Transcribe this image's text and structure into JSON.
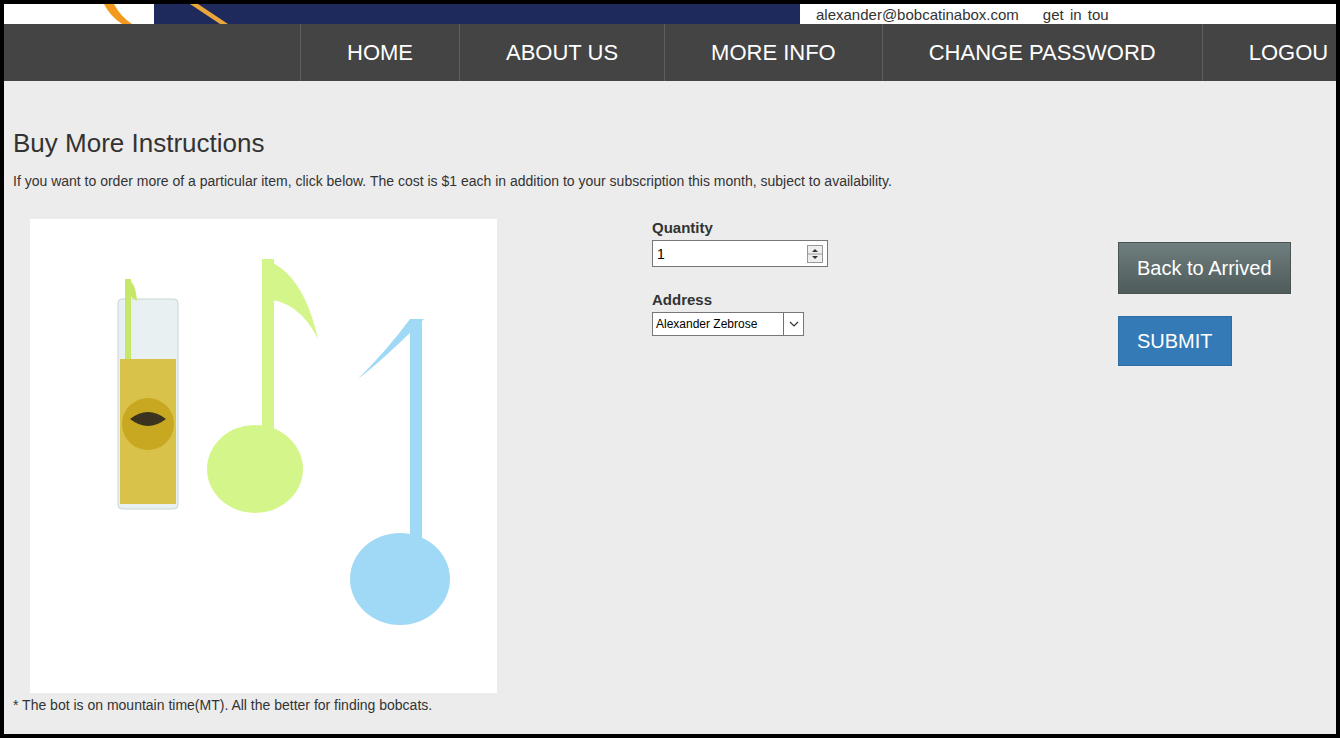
{
  "header": {
    "email": "alexander@bobcatinabox.com",
    "contact": "get in tou"
  },
  "nav": [
    {
      "label": "HOME"
    },
    {
      "label": "ABOUT US"
    },
    {
      "label": "MORE INFO"
    },
    {
      "label": "CHANGE PASSWORD"
    },
    {
      "label": "LOGOU"
    }
  ],
  "page": {
    "title": "Buy More Instructions",
    "description": "If you want to order more of a particular item, click below. The cost is $1 each in addition to your subscription this month, subject to availability."
  },
  "form": {
    "quantity": {
      "label": "Quantity",
      "value": "1"
    },
    "address": {
      "label": "Address",
      "value": "Alexander Zebrose"
    }
  },
  "buttons": [
    {
      "label": "Back to Arrived",
      "kind": "secondary"
    },
    {
      "label": "SUBMIT",
      "kind": "primary"
    }
  ],
  "footnote": "* The bot is on mountain time(MT). All the better for finding bobcats."
}
